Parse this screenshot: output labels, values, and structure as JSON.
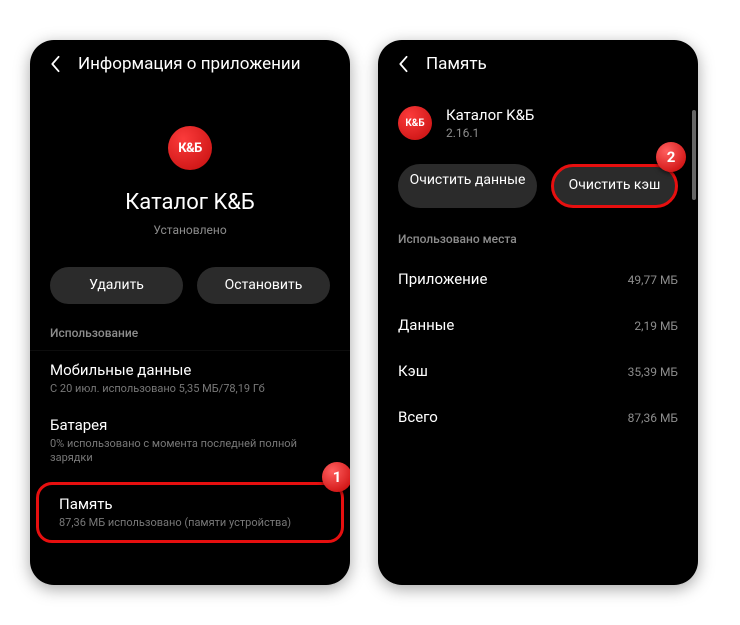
{
  "left": {
    "header_title": "Информация о приложении",
    "app_icon_text": "К&Б",
    "app_name": "Каталог K&Б",
    "app_status": "Установлено",
    "btn_uninstall": "Удалить",
    "btn_stop": "Остановить",
    "section_usage": "Использование",
    "items": [
      {
        "title": "Мобильные данные",
        "sub": "С 20 июл. использовано 5,35 МБ/78,19 Гб"
      },
      {
        "title": "Батарея",
        "sub": "0% использовано с момента последней полной зарядки"
      },
      {
        "title": "Память",
        "sub": "87,36 МБ использовано (памяти устройства)"
      }
    ],
    "badge1": "1"
  },
  "right": {
    "header_title": "Память",
    "app_icon_text": "К&Б",
    "app_name": "Каталог K&Б",
    "app_version": "2.16.1",
    "btn_clear_data": "Очистить данные",
    "btn_clear_cache": "Очистить кэш",
    "section_used": "Использовано места",
    "rows": [
      {
        "k": "Приложение",
        "v": "49,77 МБ"
      },
      {
        "k": "Данные",
        "v": "2,19 МБ"
      },
      {
        "k": "Кэш",
        "v": "35,39 МБ"
      },
      {
        "k": "Всего",
        "v": "87,36 МБ"
      }
    ],
    "badge2": "2"
  }
}
